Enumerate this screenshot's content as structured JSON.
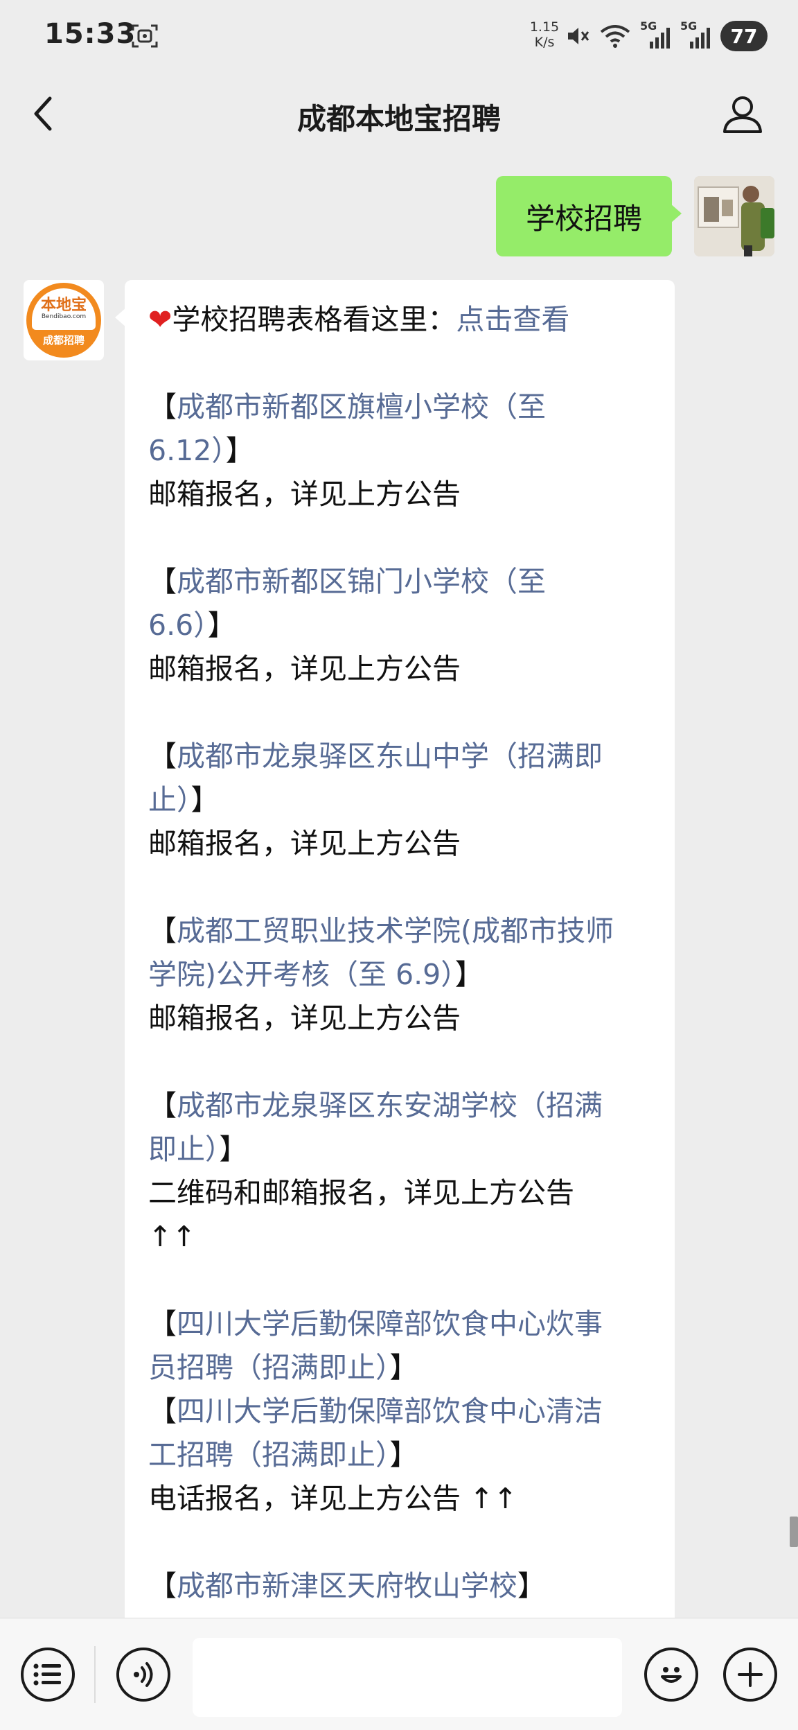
{
  "status_bar": {
    "time": "15:33",
    "net_speed_value": "1.15",
    "net_speed_unit": "K/s",
    "signal_1": "5G",
    "signal_2": "5G",
    "battery": "77"
  },
  "header": {
    "title": "成都本地宝招聘"
  },
  "outgoing_message": {
    "text": "学校招聘"
  },
  "bot_avatar": {
    "logo_text": "本地宝",
    "domain_text": "Bendibao.com",
    "subtitle": "成都招聘"
  },
  "incoming_message": {
    "intro_text": "学校招聘表格看这里：",
    "intro_link": "点击查看",
    "lines": [
      {
        "open": "【",
        "link": "成都市新都区旗檀小学校（至",
        "close": ""
      },
      {
        "open": "",
        "link": "6.12）",
        "close": "】"
      },
      {
        "text": "邮箱报名，详见上方公告"
      },
      {
        "open": "【",
        "link": "成都市新都区锦门小学校（至",
        "close": ""
      },
      {
        "open": "",
        "link": "6.6）",
        "close": "】"
      },
      {
        "text": "邮箱报名，详见上方公告"
      },
      {
        "open": "【",
        "link": "成都市龙泉驿区东山中学（招满即",
        "close": ""
      },
      {
        "open": "",
        "link": "止）",
        "close": "】"
      },
      {
        "text": "邮箱报名，详见上方公告"
      },
      {
        "open": "【",
        "link": "成都工贸职业技术学院(成都市技师",
        "close": ""
      },
      {
        "open": "",
        "link": "学院)公开考核（至 6.9）",
        "close": "】"
      },
      {
        "text": "邮箱报名，详见上方公告"
      },
      {
        "open": "【",
        "link": "成都市龙泉驿区东安湖学校（招满",
        "close": ""
      },
      {
        "open": "",
        "link": "即止）",
        "close": "】"
      },
      {
        "text": "二维码和邮箱报名，详见上方公告"
      },
      {
        "text": "↑↑"
      },
      {
        "open": "【",
        "link": "四川大学后勤保障部饮食中心炊事",
        "close": ""
      },
      {
        "open": "",
        "link": "员招聘（招满即止）",
        "close": "】"
      },
      {
        "open": "【",
        "link": "四川大学后勤保障部饮食中心清洁",
        "close": ""
      },
      {
        "open": "",
        "link": "工招聘（招满即止）",
        "close": "】"
      },
      {
        "text": "电话报名，详见上方公告 ↑↑"
      },
      {
        "open": "【",
        "link": "成都市新津区天府牧山学校",
        "close": "】"
      }
    ]
  },
  "colors": {
    "background": "#ededed",
    "outgoing_bubble": "#95ec69",
    "link": "#576b95",
    "bot_logo_orange": "#f28a1e"
  },
  "icons": [
    "back-arrow-icon",
    "profile-icon",
    "menu-list-icon",
    "voice-icon",
    "emoji-icon",
    "plus-icon",
    "screen-record-icon",
    "mute-icon",
    "wifi-icon",
    "signal-icon"
  ]
}
